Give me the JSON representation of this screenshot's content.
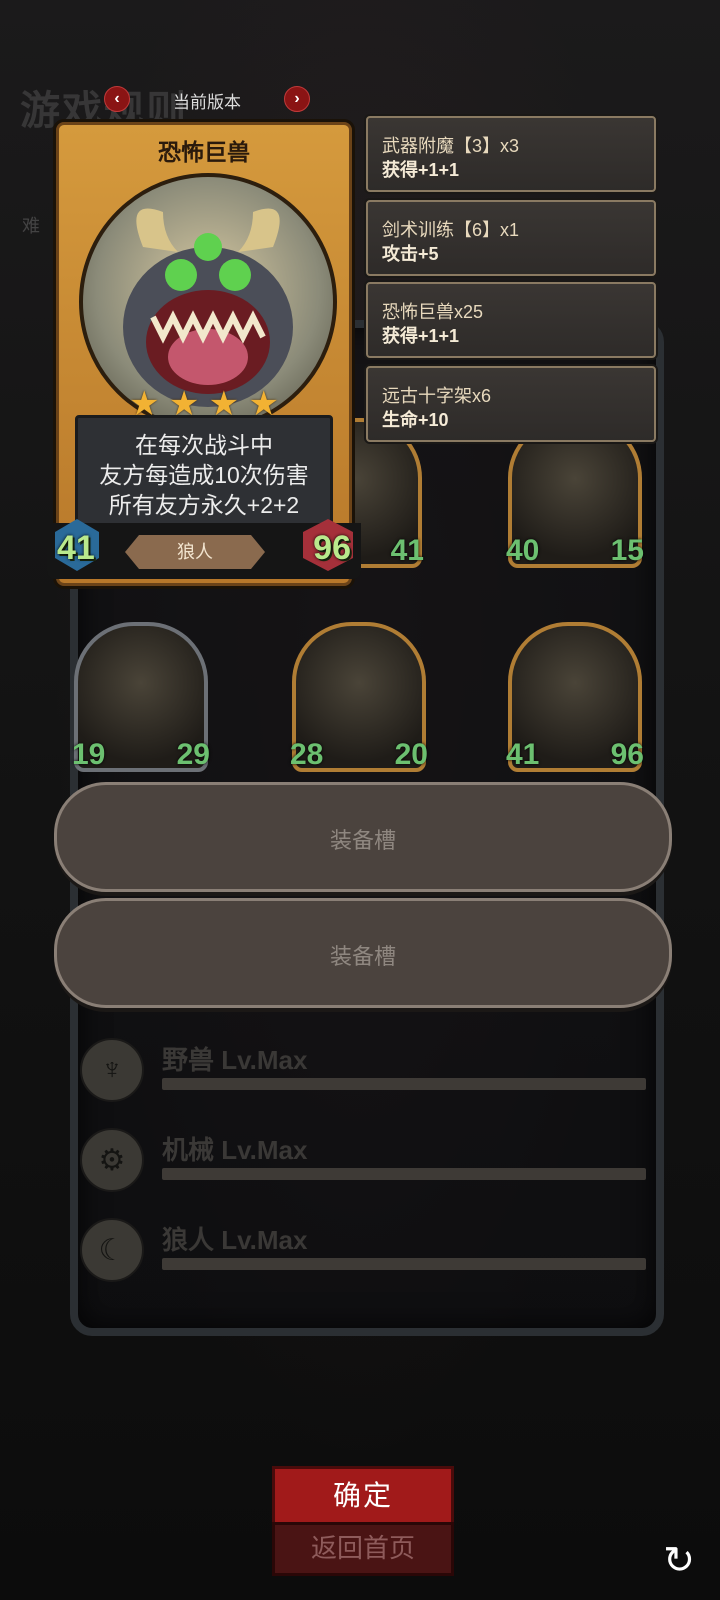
{
  "background": {
    "title": "游戏规则",
    "difficulty": "难"
  },
  "version": {
    "label": "当前版本",
    "prev_icon": "chevron-left",
    "next_icon": "chevron-right"
  },
  "card": {
    "name": "恐怖巨兽",
    "stars": 4,
    "description": [
      "在每次战斗中",
      "友方每造成10次伤害",
      "所有友方永久+2+2"
    ],
    "tribe": "狼人",
    "attack": "41",
    "health": "96"
  },
  "enchantments": [
    {
      "name": "武器附魔【3】x3",
      "effect": "获得+1+1"
    },
    {
      "name": "剑术训练【6】x1",
      "effect": "攻击+5"
    },
    {
      "name": "恐怖巨兽x25",
      "effect": "获得+1+1"
    },
    {
      "name": "远古十字架x6",
      "effect": "生命+10"
    }
  ],
  "team": [
    {
      "attack": "41",
      "health": ""
    },
    {
      "attack": "40",
      "health": "15"
    },
    {
      "attack": "19",
      "health": "29"
    },
    {
      "attack": "28",
      "health": "20"
    },
    {
      "attack": "41",
      "health": "96"
    }
  ],
  "equipment_slots": [
    "装备槽",
    "装备槽"
  ],
  "tribes": [
    {
      "label": "野兽 Lv.Max",
      "icon": "beast-icon"
    },
    {
      "label": "机械 Lv.Max",
      "icon": "mech-icon"
    },
    {
      "label": "狼人 Lv.Max",
      "icon": "werewolf-icon"
    }
  ],
  "buttons": {
    "confirm": "确定",
    "home": "返回首页",
    "refresh_icon": "refresh-icon"
  },
  "colors": {
    "accent_red": "#a11a1a",
    "stat_green": "#b9e98c",
    "card_gold": "#d59a3d"
  }
}
